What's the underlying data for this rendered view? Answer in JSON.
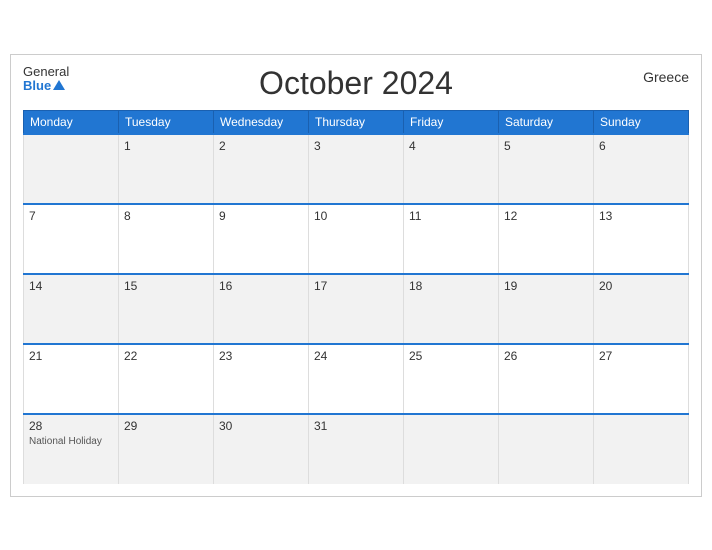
{
  "header": {
    "logo_general": "General",
    "logo_blue": "Blue",
    "title": "October 2024",
    "country": "Greece"
  },
  "days_of_week": [
    "Monday",
    "Tuesday",
    "Wednesday",
    "Thursday",
    "Friday",
    "Saturday",
    "Sunday"
  ],
  "weeks": [
    [
      {
        "num": "",
        "event": ""
      },
      {
        "num": "1",
        "event": ""
      },
      {
        "num": "2",
        "event": ""
      },
      {
        "num": "3",
        "event": ""
      },
      {
        "num": "4",
        "event": ""
      },
      {
        "num": "5",
        "event": ""
      },
      {
        "num": "6",
        "event": ""
      }
    ],
    [
      {
        "num": "7",
        "event": ""
      },
      {
        "num": "8",
        "event": ""
      },
      {
        "num": "9",
        "event": ""
      },
      {
        "num": "10",
        "event": ""
      },
      {
        "num": "11",
        "event": ""
      },
      {
        "num": "12",
        "event": ""
      },
      {
        "num": "13",
        "event": ""
      }
    ],
    [
      {
        "num": "14",
        "event": ""
      },
      {
        "num": "15",
        "event": ""
      },
      {
        "num": "16",
        "event": ""
      },
      {
        "num": "17",
        "event": ""
      },
      {
        "num": "18",
        "event": ""
      },
      {
        "num": "19",
        "event": ""
      },
      {
        "num": "20",
        "event": ""
      }
    ],
    [
      {
        "num": "21",
        "event": ""
      },
      {
        "num": "22",
        "event": ""
      },
      {
        "num": "23",
        "event": ""
      },
      {
        "num": "24",
        "event": ""
      },
      {
        "num": "25",
        "event": ""
      },
      {
        "num": "26",
        "event": ""
      },
      {
        "num": "27",
        "event": ""
      }
    ],
    [
      {
        "num": "28",
        "event": "National Holiday"
      },
      {
        "num": "29",
        "event": ""
      },
      {
        "num": "30",
        "event": ""
      },
      {
        "num": "31",
        "event": ""
      },
      {
        "num": "",
        "event": ""
      },
      {
        "num": "",
        "event": ""
      },
      {
        "num": "",
        "event": ""
      }
    ]
  ]
}
